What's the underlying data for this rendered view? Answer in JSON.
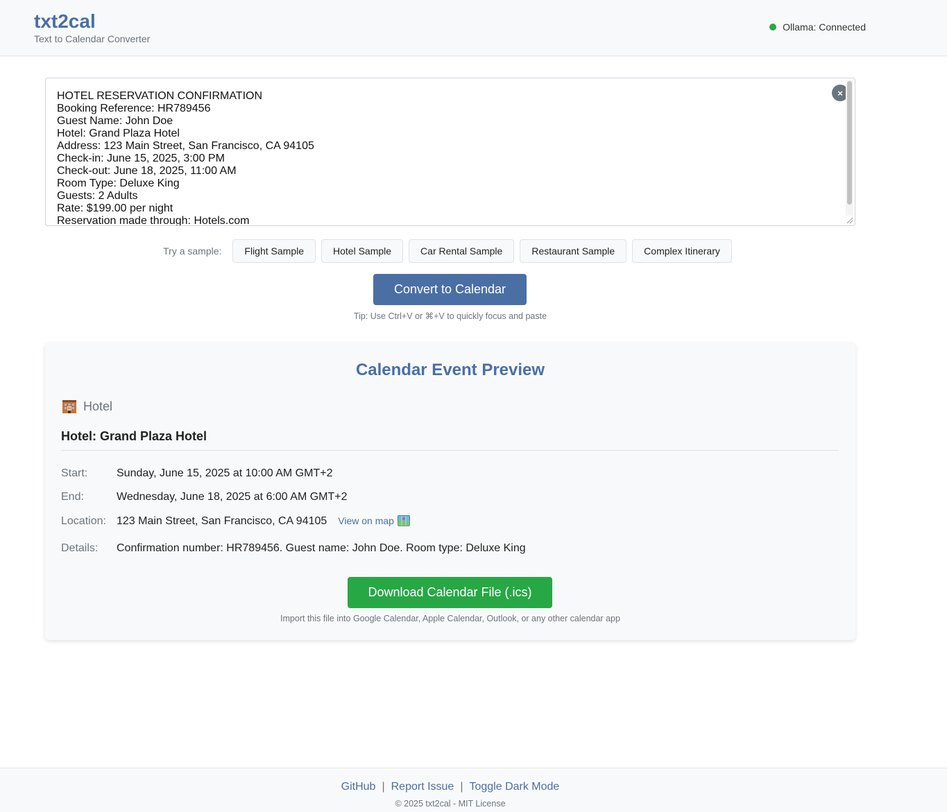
{
  "header": {
    "title": "txt2cal",
    "subtitle": "Text to Calendar Converter",
    "status": "Ollama: Connected",
    "status_color": "#28a745"
  },
  "input": {
    "text": "HOTEL RESERVATION CONFIRMATION\nBooking Reference: HR789456\nGuest Name: John Doe\nHotel: Grand Plaza Hotel\nAddress: 123 Main Street, San Francisco, CA 94105\nCheck-in: June 15, 2025, 3:00 PM\nCheck-out: June 18, 2025, 11:00 AM\nRoom Type: Deluxe King\nGuests: 2 Adults\nRate: $199.00 per night\nReservation made through: Hotels.com",
    "clear_label": "×"
  },
  "samples": {
    "label": "Try a sample:",
    "buttons": [
      "Flight Sample",
      "Hotel Sample",
      "Car Rental Sample",
      "Restaurant Sample",
      "Complex Itinerary"
    ]
  },
  "convert": {
    "label": "Convert to Calendar",
    "tip": "Tip: Use Ctrl+V or ⌘+V to quickly focus and paste"
  },
  "preview": {
    "title": "Calendar Event Preview",
    "event_type": "Hotel",
    "event_type_icon": "hotel-icon",
    "event_title": "Hotel: Grand Plaza Hotel",
    "start_label": "Start:",
    "start_value": "Sunday, June 15, 2025 at 10:00 AM GMT+2",
    "end_label": "End:",
    "end_value": "Wednesday, June 18, 2025 at 6:00 AM GMT+2",
    "location_label": "Location:",
    "location_value": "123 Main Street, San Francisco, CA 94105",
    "map_link": "View on map",
    "map_icon": "map-icon",
    "details_label": "Details:",
    "details_value": "Confirmation number: HR789456. Guest name: John Doe. Room type: Deluxe King",
    "download_label": "Download Calendar File (.ics)",
    "import_note": "Import this file into Google Calendar, Apple Calendar, Outlook, or any other calendar app"
  },
  "footer": {
    "links": [
      "GitHub",
      "Report Issue",
      "Toggle Dark Mode"
    ],
    "separator": "|",
    "copyright": "© 2025 txt2cal - MIT License"
  },
  "colors": {
    "accent": "#4a6fa5",
    "success": "#28a745"
  }
}
